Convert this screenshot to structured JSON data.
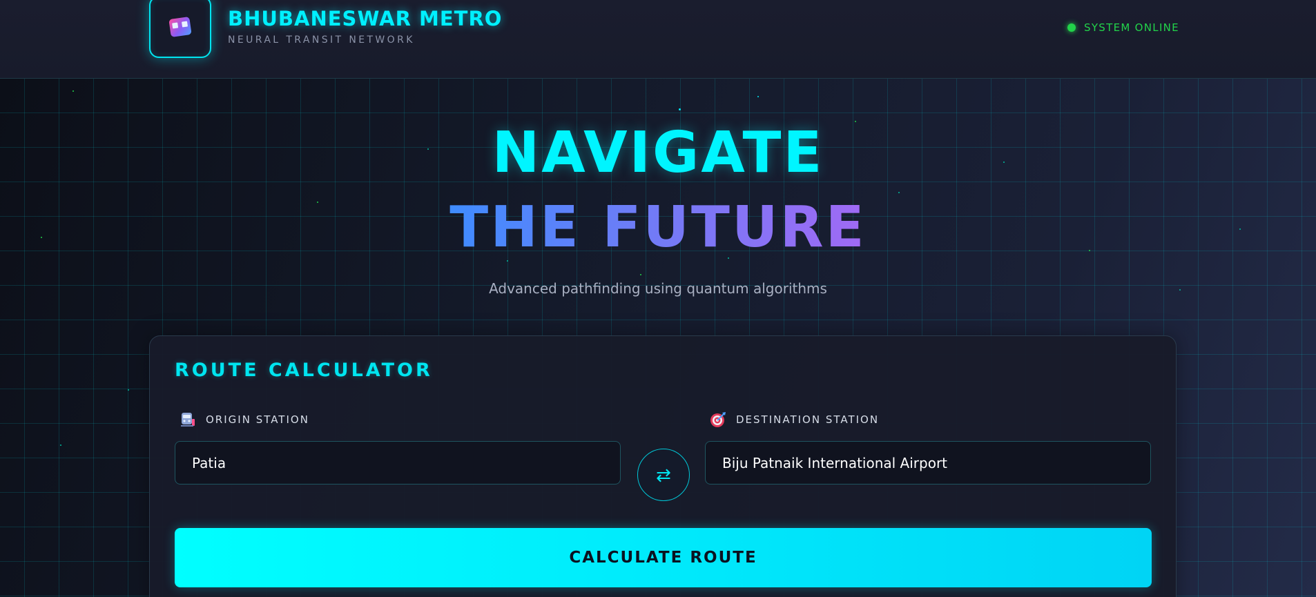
{
  "header": {
    "brand_title": "BHUBANESWAR METRO",
    "brand_subtitle": "NEURAL TRANSIT NETWORK",
    "logo_icon": "metro-train-icon",
    "status_text": "SYSTEM ONLINE",
    "status_color": "#22d34a"
  },
  "hero": {
    "line1": "NAVIGATE",
    "line2": "THE FUTURE",
    "subtitle": "Advanced pathfinding using quantum algorithms"
  },
  "route_calculator": {
    "title": "ROUTE CALCULATOR",
    "origin": {
      "label": "ORIGIN STATION",
      "icon": "station-train-icon",
      "value": "Patia"
    },
    "destination": {
      "label": "DESTINATION STATION",
      "icon": "target-icon",
      "value": "Biju Patnaik International Airport"
    },
    "swap_icon": "swap-arrows-icon",
    "swap_glyph": "⇄",
    "calculate_label": "CALCULATE ROUTE"
  },
  "colors": {
    "accent_cyan": "#00f0ff",
    "gradient_blue": "#3f8cff",
    "gradient_purple": "#a06af5"
  }
}
